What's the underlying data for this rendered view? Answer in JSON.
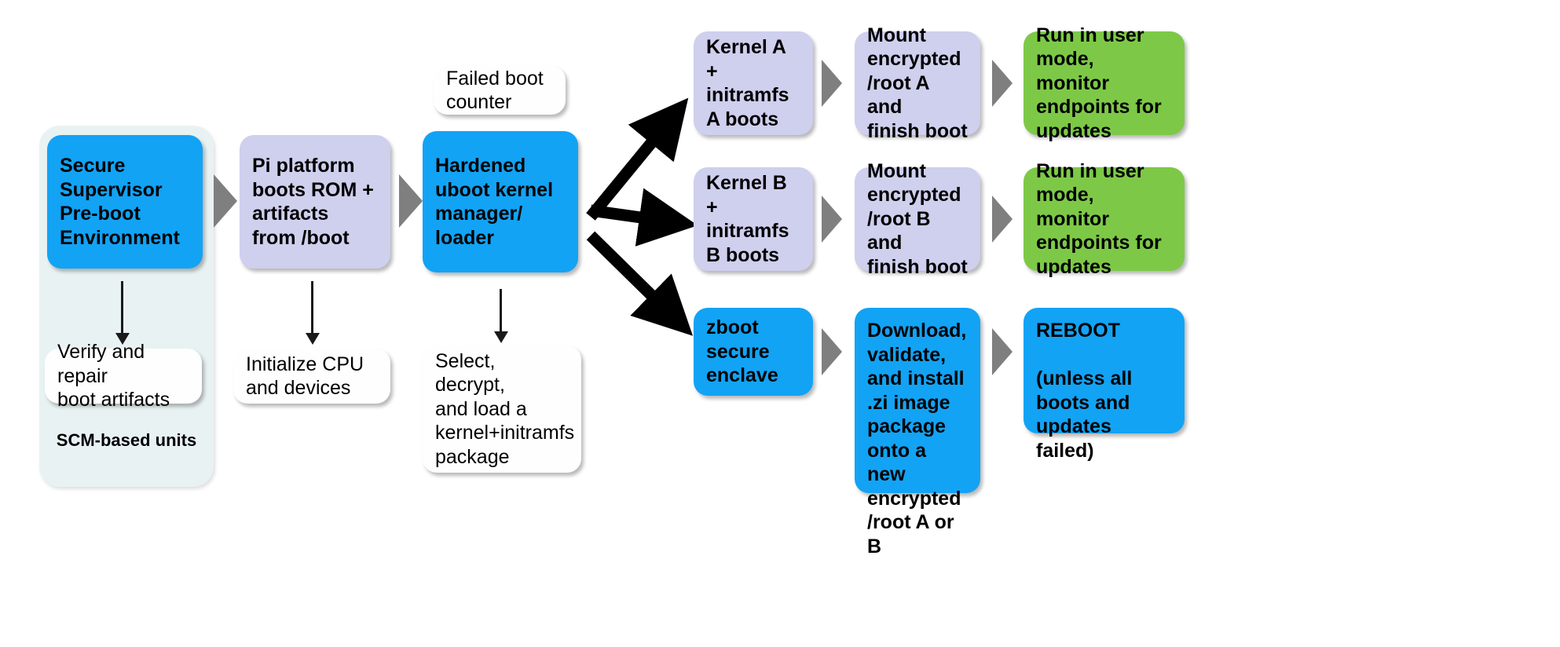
{
  "diagram": {
    "title": "Secure boot and update flow",
    "colors": {
      "blue": "#12A3F5",
      "lavender": "#CFCFEE",
      "green": "#7DC947",
      "white": "#FEFEFE",
      "group_background": "#E9F2F2",
      "chevron_grey": "#7F7F7F",
      "arrow_black": "#1A1A1A"
    }
  },
  "group": {
    "label": "SCM-based units"
  },
  "nodes": {
    "secure_supervisor": "Secure\nSupervisor\nPre-boot\nEnvironment",
    "verify_repair": "Verify and repair\nboot artifacts",
    "pi_platform": "Pi platform\nboots ROM +\nartifacts\nfrom /boot",
    "initialize_cpu": "Initialize CPU\nand devices",
    "failed_boot_counter": "Failed boot\ncounter",
    "hardened_uboot": "Hardened\nuboot kernel\nmanager/\nloader",
    "select_decrypt": "Select, decrypt,\nand load a\nkernel+initramfs\npackage",
    "kernel_a": "Kernel A +\ninitramfs\nA boots",
    "mount_root_a": "Mount\nencrypted\n/root A and\nfinish boot",
    "run_user_mode_a": "Run in user\nmode, monitor\nendpoints for\nupdates",
    "kernel_b": "Kernel B +\ninitramfs\nB boots",
    "mount_root_b": "Mount\nencrypted\n/root B and\nfinish boot",
    "run_user_mode_b": "Run in user\nmode, monitor\nendpoints for\nupdates",
    "zboot_enclave": "zboot\nsecure\nenclave",
    "download_install": "Download,\nvalidate,\nand install\n.zi image\npackage\nonto a new\nencrypted\n/root A or B",
    "reboot": "REBOOT\n\n(unless all\nboots and\nupdates failed)"
  }
}
